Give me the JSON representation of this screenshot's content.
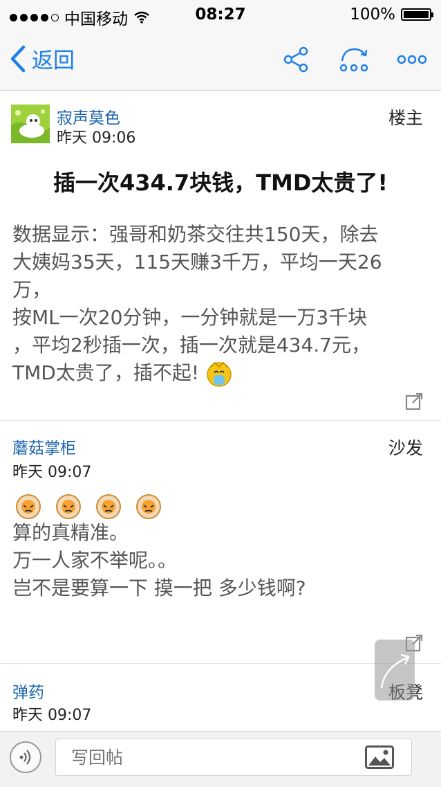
{
  "status_bar": {
    "carrier": "中国移动",
    "time": "08:27",
    "battery": "100%"
  },
  "nav": {
    "back_label": "返回",
    "icons": [
      "share-icon",
      "forward-icon",
      "more-icon"
    ]
  },
  "posts": [
    {
      "username": "寂声莫色",
      "time": "昨天 09:06",
      "floor": "楼主",
      "title": "插一次434.7块钱，TMD太贵了!",
      "body_lines": [
        "数据显示：强哥和奶茶交往共150天，除去",
        "大姨妈35天，115天赚3千万，平均一天26",
        "万，",
        "按ML一次20分钟，一分钟就是一万3千块",
        "，平均2秒插一次，插一次就是434.7元，",
        "TMD太贵了，插不起!"
      ]
    },
    {
      "username": "蘑菇掌柜",
      "time": "昨天 09:07",
      "floor": "沙发",
      "body_lines": [
        "算的真精准。",
        "万一人家不举呢。。",
        "岂不是要算一下  摸一把  多少钱啊?"
      ]
    },
    {
      "username": "弹药",
      "time": "昨天 09:07",
      "floor": "板凳"
    }
  ],
  "reply_bar": {
    "placeholder": "写回帖"
  },
  "colors": {
    "accent": "#1e7fe6",
    "username": "#1a64ad",
    "body_text": "#555555"
  }
}
